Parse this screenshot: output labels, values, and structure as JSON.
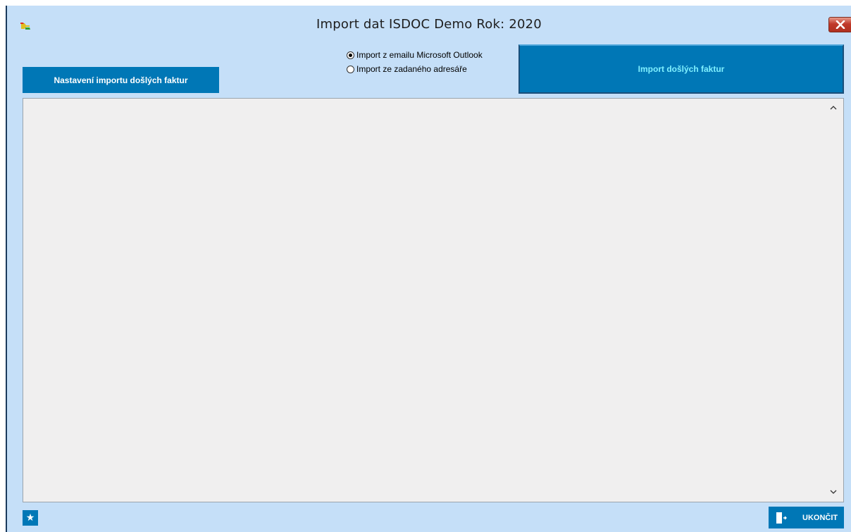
{
  "window": {
    "title": "Import dat  ISDOC  Demo  Rok: 2020",
    "background": "#c5dff8"
  },
  "toolbar": {
    "settings_label": "Nastavení importu došlých faktur",
    "import_label": "Import došlých faktur",
    "accent": "#0077b6"
  },
  "import_source": {
    "options": [
      {
        "label": "Import z emailu Microsoft Outlook",
        "selected": true
      },
      {
        "label": "Import ze zadaného adresáře",
        "selected": false
      }
    ]
  },
  "footer": {
    "favorite_icon": "star-icon",
    "exit_label": "UKONČIT",
    "exit_icon": "door-exit-icon"
  }
}
